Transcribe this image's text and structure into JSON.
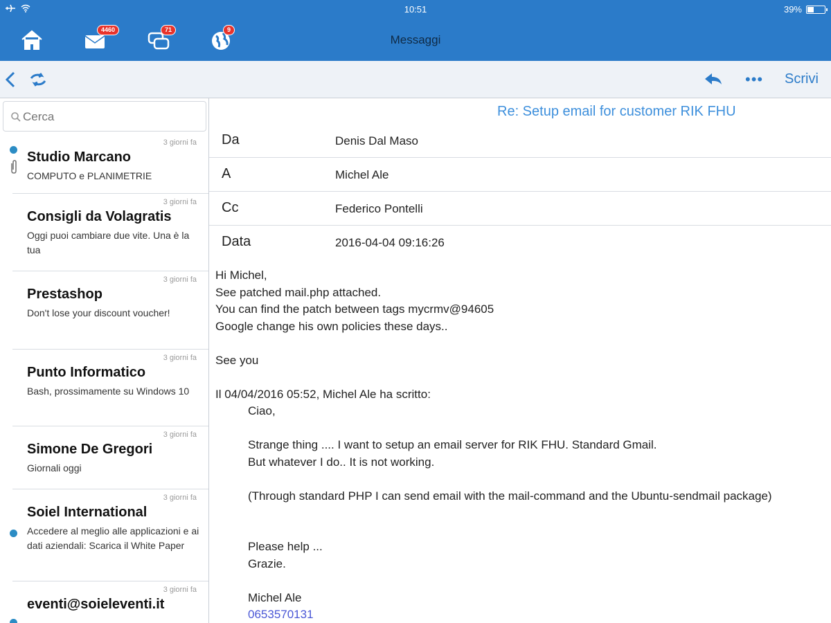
{
  "status_bar": {
    "time": "10:51",
    "battery_text": "39%",
    "battery_level": 0.39
  },
  "header": {
    "title": "Messaggi",
    "badges": {
      "mail": "4460",
      "chat": "71",
      "web": "9"
    }
  },
  "toolbar": {
    "more_label": "•••",
    "compose_label": "Scrivi"
  },
  "search": {
    "placeholder": "Cerca"
  },
  "messages": [
    {
      "date": "3 giorni fa",
      "sender": "Studio Marcano",
      "preview": "COMPUTO e PLANIMETRIE",
      "unread": true,
      "attachment": true
    },
    {
      "date": "3 giorni fa",
      "sender": "Consigli da Volagratis",
      "preview": "Oggi puoi cambiare due vite. Una è la tua",
      "unread": false,
      "attachment": false
    },
    {
      "date": "3 giorni fa",
      "sender": "Prestashop",
      "preview": "Don't lose your discount voucher!",
      "unread": false,
      "attachment": false
    },
    {
      "date": "3 giorni fa",
      "sender": "Punto Informatico",
      "preview": "Bash, prossimamente su Windows 10",
      "unread": false,
      "attachment": false
    },
    {
      "date": "3 giorni fa",
      "sender": "Simone De Gregori",
      "preview": "Giornali oggi",
      "unread": false,
      "attachment": false
    },
    {
      "date": "3 giorni fa",
      "sender": "Soiel International",
      "preview": "Accedere al meglio alle applicazioni e ai dati aziendali: Scarica il White Paper",
      "unread": true,
      "attachment": false
    },
    {
      "date": "3 giorni fa",
      "sender": "eventi@soieleventi.it",
      "preview": "",
      "unread": true,
      "attachment": false
    }
  ],
  "email": {
    "subject": "Re: Setup email for customer RIK FHU",
    "headers": [
      {
        "key": "Da",
        "value": "Denis Dal Maso"
      },
      {
        "key": "A",
        "value": "Michel Ale"
      },
      {
        "key": "Cc",
        "value": "Federico Pontelli"
      },
      {
        "key": "Data",
        "value": "2016-04-04 09:16:26"
      }
    ],
    "body": {
      "l1": "Hi Michel,",
      "l2": "See patched mail.php attached.",
      "l3": "You can find the patch between tags mycrmv@94605",
      "l4": "Google change his own policies these days..",
      "l5": "See you",
      "l6": "Il 04/04/2016 05:52, Michel Ale ha scritto:",
      "q1": "Ciao,",
      "q2": "Strange thing .... I want to setup an email server for RIK FHU. Standard Gmail.",
      "q3": "But whatever I do.. It is not working.",
      "q4": "(Through standard PHP I can send email with the mail-command and the Ubuntu-sendmail package)",
      "q5": "Please help ...",
      "q6": "Grazie.",
      "q7": "Michel Ale",
      "q8": "0653570131"
    }
  },
  "colors": {
    "header_blue": "#2b7bc9",
    "accent_blue": "#3d8fdc",
    "badge_red": "#e8332b",
    "unread_dot": "#2b8cc4"
  }
}
